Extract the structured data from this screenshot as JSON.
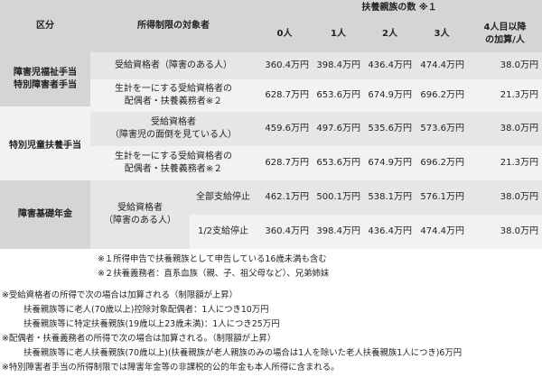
{
  "header": {
    "category": "区分",
    "target": "所得制限の対象者",
    "dependents_title": "扶養親族の数 ※１",
    "cols": [
      "0人",
      "1人",
      "2人",
      "3人"
    ],
    "extra_line1": "4人目以降",
    "extra_line2": "の加算/人"
  },
  "groups": {
    "g1_line1": "障害児福祉手当",
    "g1_line2": "特別障害者手当",
    "g2": "特別児童扶養手当",
    "g3": "障害基礎年金"
  },
  "rows": [
    {
      "target": "受給資格者（障害のある人）",
      "values": [
        "360.4万円",
        "398.4万円",
        "436.4万円",
        "474.4万円",
        "38.0万円"
      ]
    },
    {
      "target_line1": "生計を一にする受給資格者の",
      "target_line2": "配偶者・扶養義務者※２",
      "values": [
        "628.7万円",
        "653.6万円",
        "674.9万円",
        "696.2万円",
        "21.3万円"
      ]
    },
    {
      "target_line1": "受給資格者",
      "target_line2": "（障害児の面倒を見ている人）",
      "values": [
        "459.6万円",
        "497.6万円",
        "535.6万円",
        "573.6万円",
        "38.0万円"
      ]
    },
    {
      "target_line1": "生計を一にする受給資格者の",
      "target_line2": "配偶者・扶養義務者※２",
      "values": [
        "628.7万円",
        "653.6万円",
        "674.9万円",
        "696.2万円",
        "21.3万円"
      ]
    },
    {
      "target_line1": "受給資格者",
      "target_line2": "（障害のある人）",
      "sub": "全部支給停止",
      "values": [
        "462.1万円",
        "500.1万円",
        "538.1万円",
        "576.1万円",
        "38.0万円"
      ]
    },
    {
      "sub": "1/2支給停止",
      "values": [
        "360.4万円",
        "398.4万円",
        "436.4万円",
        "474.4万円",
        "38.0万円"
      ]
    }
  ],
  "notes": [
    "※１所得申告で扶養親族として申告している16歳未満も含む",
    "※２扶養義務者：直系血族（親、子、祖父母など）、兄弟姉妹",
    "※受給資格者の所得で次の場合は加算される（制限額が上昇）",
    "扶養親族等に老人(70歳以上)控除対象配偶者：1人につき10万円",
    "扶養親族等に特定扶養親族(19歳以上23歳未満)：1人につき25万円",
    "※配偶者・扶養義務者の所得で次の場合は加算される。（制限額が上昇）",
    "扶養親族等に老人扶養親族(70歳以上)(扶養親族が老人親族のみの場合は1人を除いた老人扶養親族1人につき)6万円",
    "※特別障害者手当の所得制限では障害年金等の非課税的公的年金も本人所得に含まれる。"
  ]
}
